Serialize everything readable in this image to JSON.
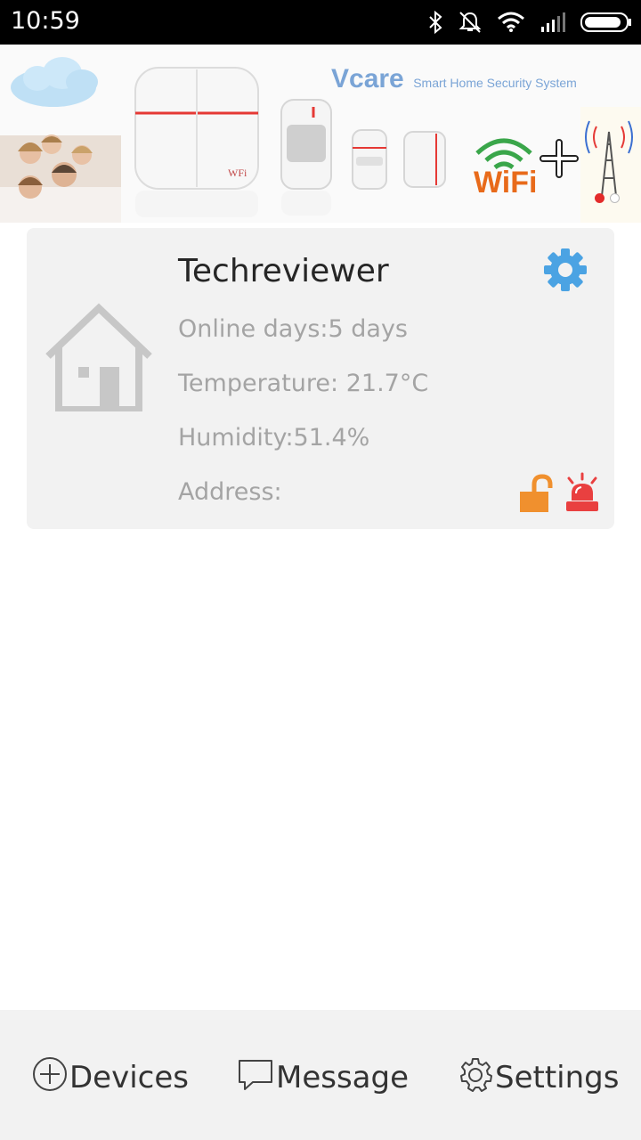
{
  "status_bar": {
    "time": "10:59",
    "icons": [
      "bluetooth-icon",
      "notifications-muted-icon",
      "wifi-icon",
      "signal-icon",
      "battery-icon"
    ]
  },
  "banner": {
    "brand_name": "Vcare",
    "brand_tagline": "Smart Home Security System",
    "wifi_text": "WiFi",
    "panel_wifi_mark": "WFi",
    "active_slide_index": 0,
    "slide_count": 2
  },
  "device": {
    "name": "Techreviewer",
    "online_days": "Online days:5 days",
    "temperature": "Temperature: 21.7°C",
    "humidity": "Humidity:51.4%",
    "address": "Address:",
    "lock_state": "unlocked"
  },
  "colors": {
    "accent_blue": "#4ba3e3",
    "lock_orange": "#f0902e",
    "siren_red": "#e94040",
    "text_dark": "#262626",
    "text_muted": "#a4a4a4"
  },
  "bottom_nav": {
    "devices": "Devices",
    "message": "Message",
    "settings": "Settings"
  }
}
